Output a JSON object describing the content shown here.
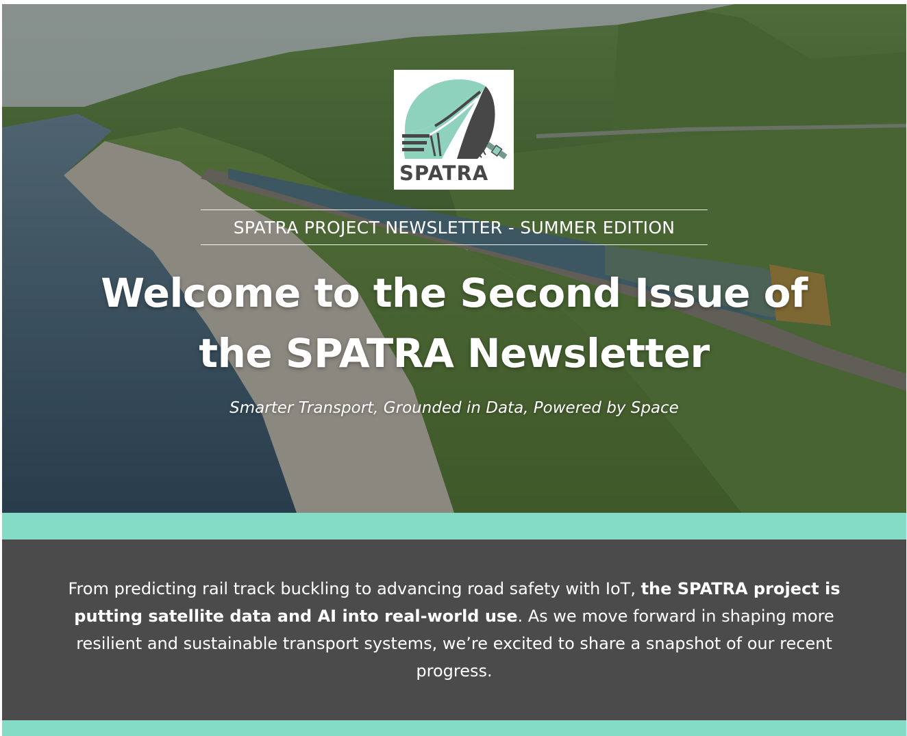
{
  "logo": {
    "wordmark": "SPATRA"
  },
  "hero": {
    "edition": "SPATRA PROJECT NEWSLETTER - SUMMER EDITION",
    "headline": "Welcome to the Second Issue of the SPATRA Newsletter",
    "tagline": "Smarter Transport, Grounded in Data, Powered by Space"
  },
  "intro": {
    "part1": "From predicting rail track buckling to advancing road safety with IoT, ",
    "bold": "the SPATRA project is putting satellite data and AI into real-world use",
    "part2": ". As we move forward in shaping more resilient and sustainable transport systems, we’re excited to share a snapshot of our recent progress."
  },
  "colors": {
    "accent": "#84dcc6",
    "panel": "#4b4b4b",
    "logo_teal": "#8ed1bc",
    "logo_dark": "#474747"
  }
}
